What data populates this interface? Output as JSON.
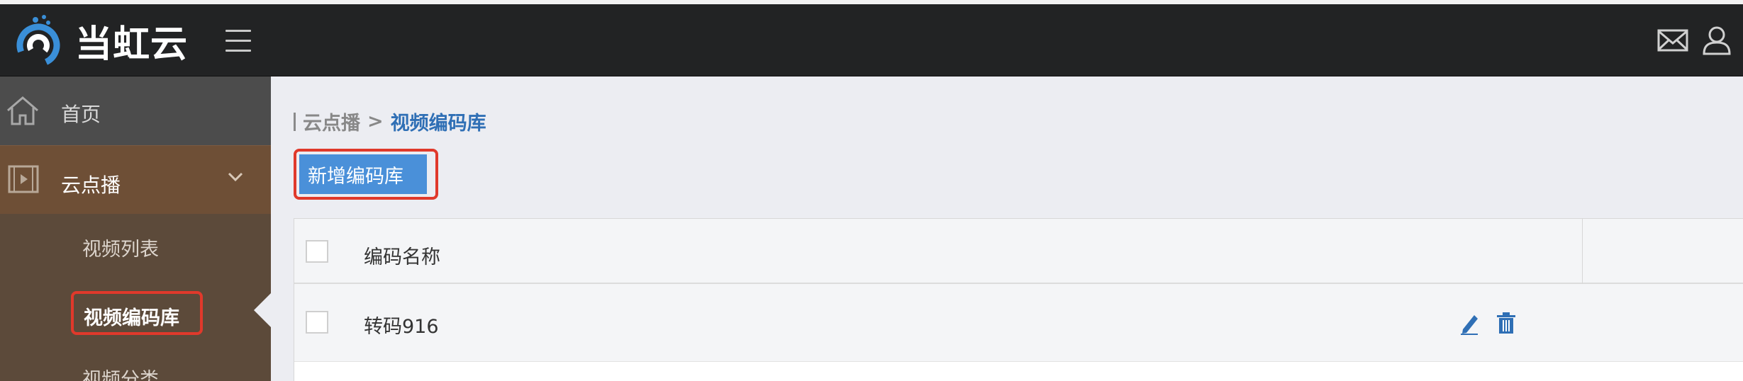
{
  "header": {
    "brand": "当虹云",
    "icons": [
      "menu-icon",
      "mail-icon",
      "user-icon"
    ]
  },
  "sidebar": {
    "items": [
      {
        "label": "首页",
        "icon": "home-icon"
      },
      {
        "label": "云点播",
        "icon": "film-icon",
        "expanded": true
      }
    ],
    "sub_items": [
      {
        "label": "视频列表"
      },
      {
        "label": "视频编码库",
        "active": true
      },
      {
        "label": "视频分类"
      }
    ]
  },
  "breadcrumb": {
    "parent": "云点播",
    "separator": ">",
    "current": "视频编码库"
  },
  "toolbar": {
    "add_label": "新增编码库"
  },
  "table": {
    "columns": [
      "编码名称"
    ],
    "rows": [
      {
        "name": "转码916",
        "actions": [
          "edit-icon",
          "delete-icon"
        ]
      }
    ]
  },
  "colors": {
    "header_bg": "#222324",
    "sidebar_bg": "#5c4a3a",
    "accent_blue": "#4a90d9",
    "highlight_red": "#e0392b",
    "link_blue": "#2f6fb5"
  }
}
